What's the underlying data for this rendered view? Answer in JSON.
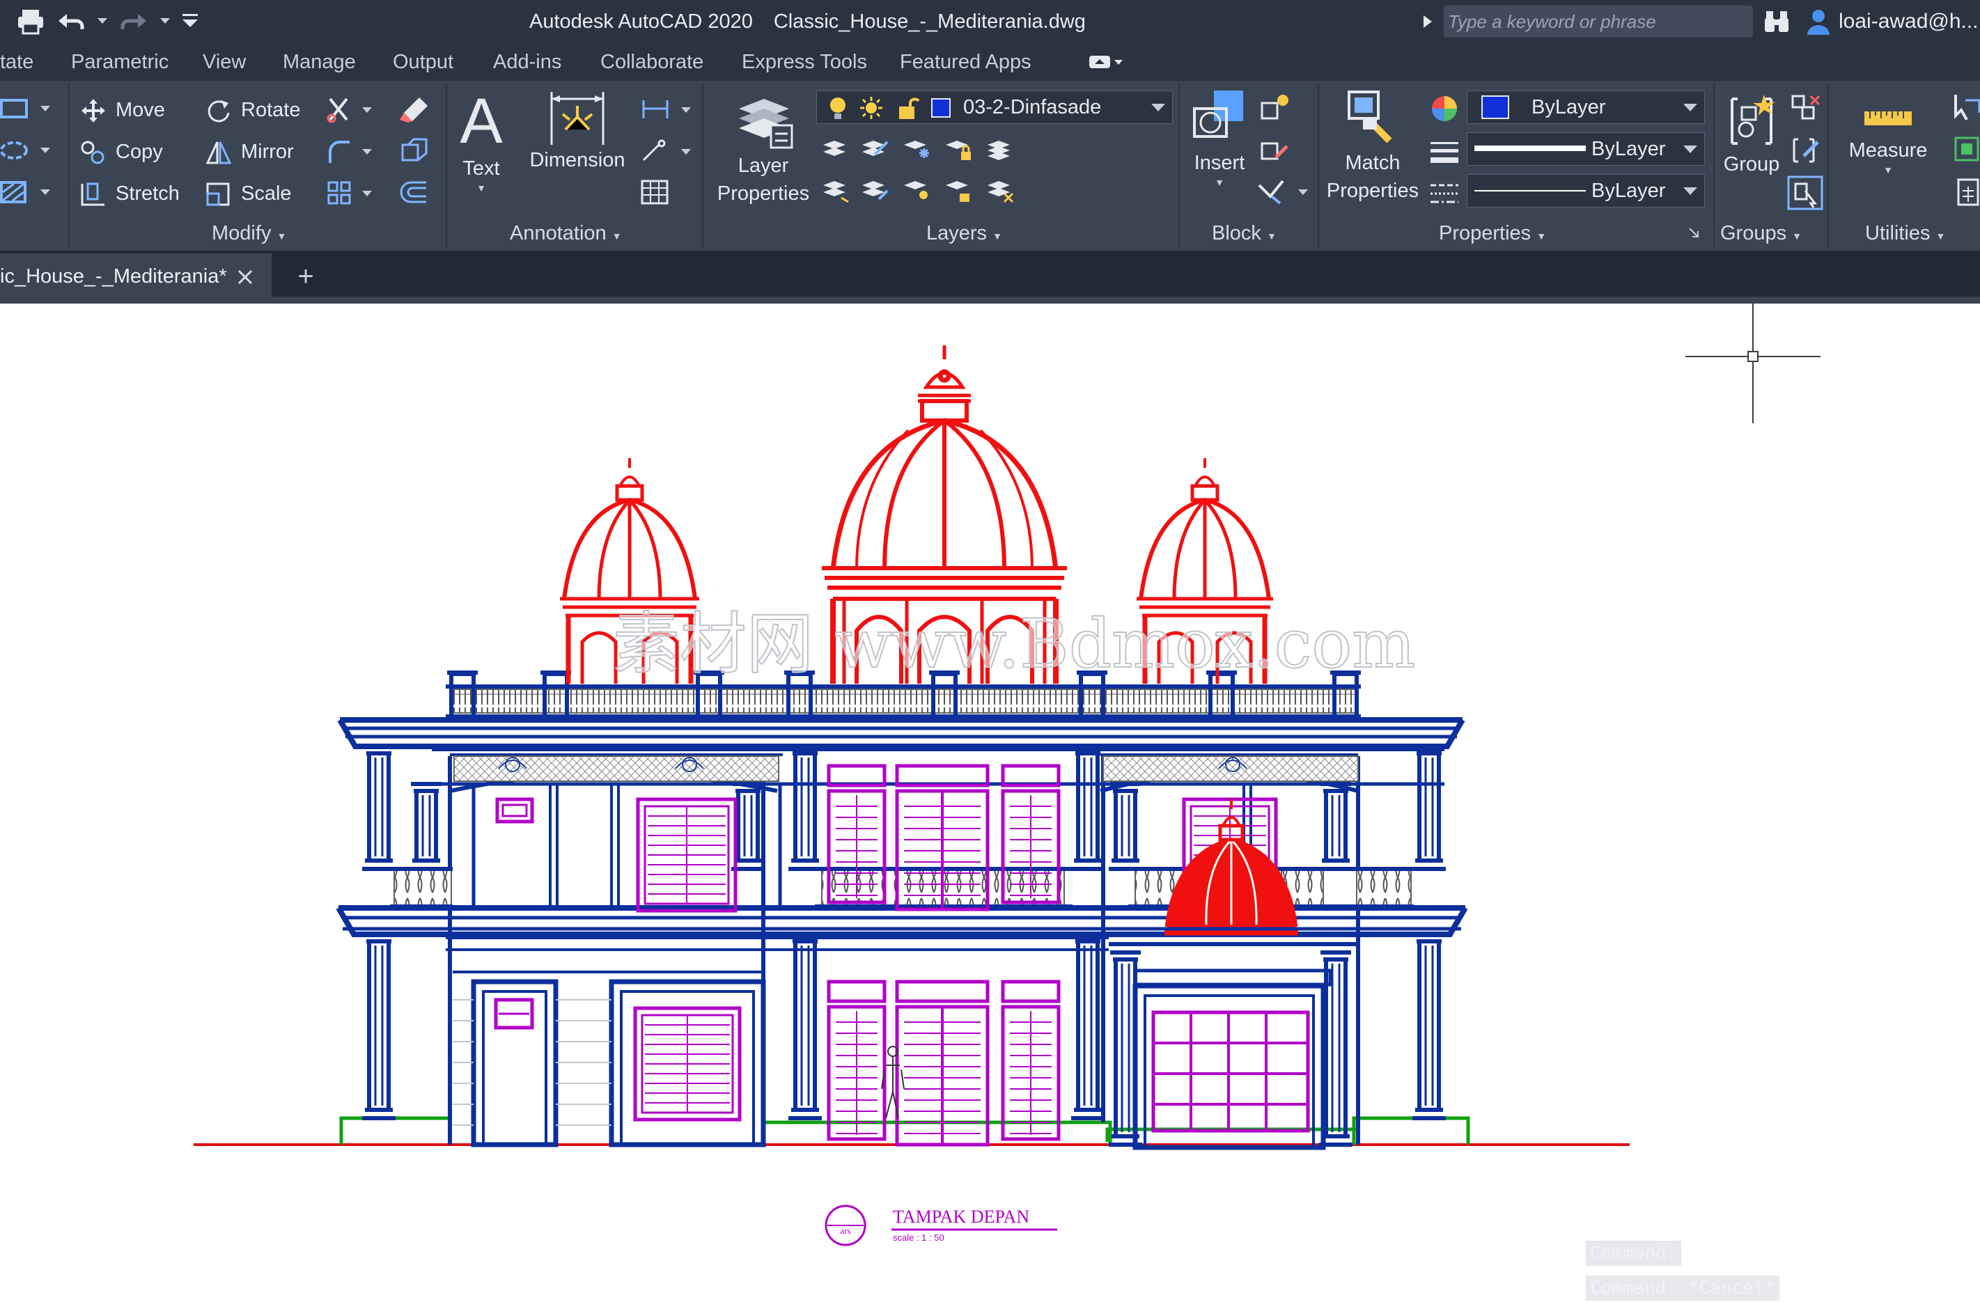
{
  "titlebar": {
    "app_name": "Autodesk AutoCAD 2020",
    "file_name": "Classic_House_-_Mediterania.dwg",
    "search_placeholder": "Type a keyword or phrase",
    "user": "loai-awad@h..."
  },
  "menu": {
    "items": [
      "tate",
      "Parametric",
      "View",
      "Manage",
      "Output",
      "Add-ins",
      "Collaborate",
      "Express Tools",
      "Featured Apps"
    ]
  },
  "ribbon": {
    "modify": {
      "title": "Modify",
      "move": "Move",
      "copy": "Copy",
      "stretch": "Stretch",
      "rotate": "Rotate",
      "mirror": "Mirror",
      "scale": "Scale"
    },
    "annotation": {
      "title": "Annotation",
      "text": "Text",
      "dimension": "Dimension"
    },
    "layers": {
      "title": "Layers",
      "layer_properties_1": "Layer",
      "layer_properties_2": "Properties",
      "current_layer": "03-2-Dinfasade",
      "layer_color": "#1030d8"
    },
    "block": {
      "title": "Block",
      "insert": "Insert"
    },
    "properties": {
      "title": "Properties",
      "match_1": "Match",
      "match_2": "Properties",
      "color": "ByLayer",
      "lineweight": "ByLayer",
      "linetype": "ByLayer",
      "color_swatch": "#1030d8"
    },
    "groups": {
      "title": "Groups",
      "group": "Group"
    },
    "utilities": {
      "title": "Utilities",
      "measure": "Measure"
    }
  },
  "doc_tabs": {
    "active": "ic_House_-_Mediterania*",
    "new_tab": "+"
  },
  "drawing": {
    "title": "TAMPAK DEPAN",
    "scale": "scale : 1 : 50",
    "bubble": "ars",
    "watermark": "素材网 www.Bdmox.com",
    "colors": {
      "roof": "#f01010",
      "structure": "#0c2f9c",
      "openings": "#b000c8",
      "ground": "#e01010",
      "base": "#10a010",
      "rail": "#606060"
    }
  },
  "command_line": [
    "Command:",
    "Command: *Cancel*"
  ]
}
